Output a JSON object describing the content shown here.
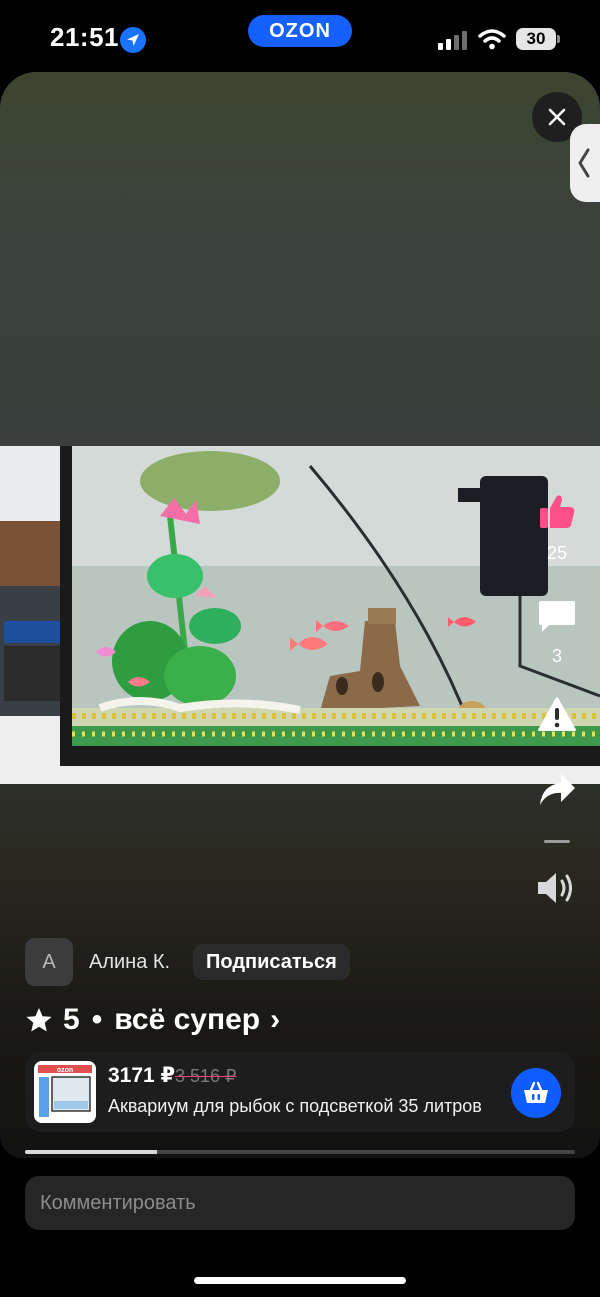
{
  "status_bar": {
    "time": "21:51",
    "brand_pill": "OZON",
    "battery": "30"
  },
  "actions": {
    "likes_count": "25",
    "comments_count": "3"
  },
  "author": {
    "avatar_letter": "А",
    "name": "Алина К.",
    "subscribe_label": "Подписаться"
  },
  "review": {
    "rating": "5",
    "separator": "•",
    "text": "всё супер",
    "chevron": "›"
  },
  "product": {
    "price": "3171 ₽",
    "old_price": "3 516 ₽",
    "title": "Аквариум для рыбок с подсветкой 35 литров",
    "thumb_label": "ozon"
  },
  "video_progress": 0.24,
  "comment": {
    "placeholder": "Комментировать"
  },
  "colors": {
    "accent": "#0f5cff",
    "like": "#ff4f8b",
    "old_price_strike": "#ff3d8a"
  }
}
